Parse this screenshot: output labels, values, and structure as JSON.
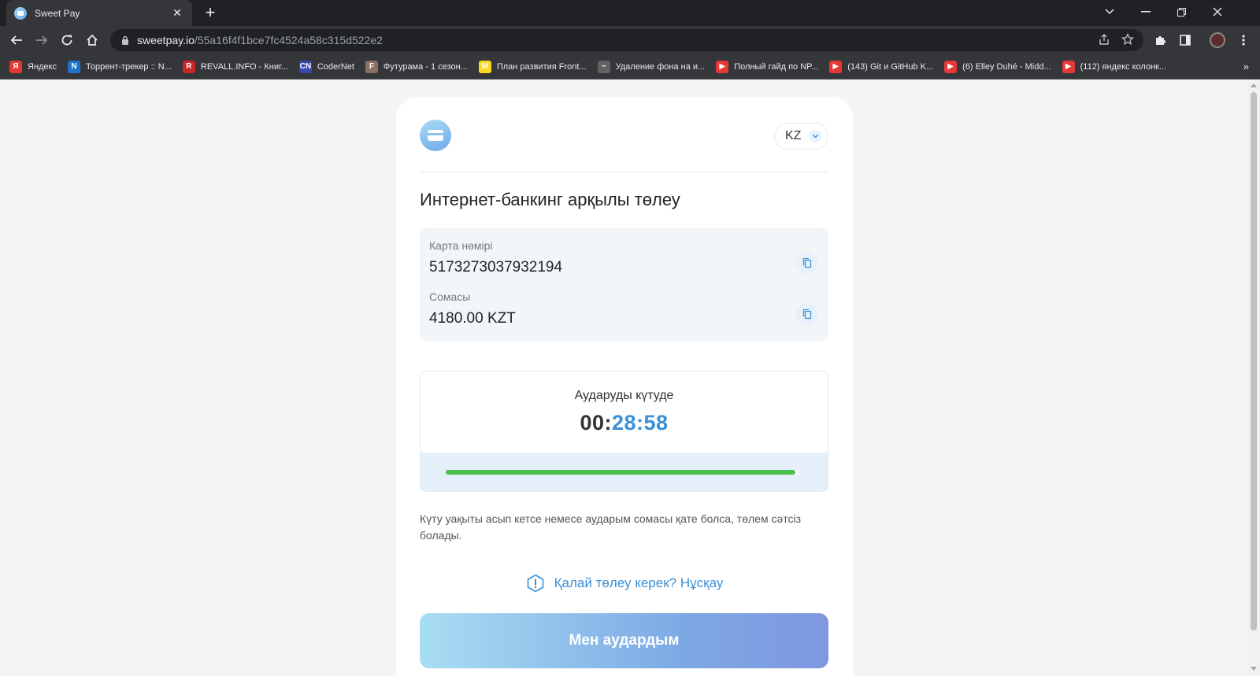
{
  "browser": {
    "tab_title": "Sweet Pay",
    "tab_close": "✕",
    "new_tab": "+",
    "url_host": "sweetpay.io",
    "url_path": "/55a16f4f1bce7fc4524a58c315d522e2",
    "bookmarks": [
      {
        "label": "Яндекс",
        "icon_text": "Я",
        "color": "#e53935"
      },
      {
        "label": "Торрент-трекер :: N...",
        "icon_text": "N",
        "color": "#1e73c8"
      },
      {
        "label": "REVALL.INFO - Книг...",
        "icon_text": "R",
        "color": "#c62828"
      },
      {
        "label": "CoderNet",
        "icon_text": "CN",
        "color": "#3949ab"
      },
      {
        "label": "Футурама - 1 сезон...",
        "icon_text": "F",
        "color": "#8d6e63"
      },
      {
        "label": "План развития Front...",
        "icon_text": "M",
        "color": "#f9d923"
      },
      {
        "label": "Удаление фона на и...",
        "icon_text": "~",
        "color": "#616161"
      },
      {
        "label": "Полный гайд по NP...",
        "icon_text": "▶",
        "color": "#e53935"
      },
      {
        "label": "(143) Git и GitHub K...",
        "icon_text": "▶",
        "color": "#e53935"
      },
      {
        "label": "(6) Elley Duhé - Midd...",
        "icon_text": "▶",
        "color": "#e53935"
      },
      {
        "label": "(112) яндекс колонк...",
        "icon_text": "▶",
        "color": "#e53935"
      }
    ],
    "bookmarks_more": "»"
  },
  "header": {
    "language": "KZ"
  },
  "title": "Интернет-банкинг арқылы төлеу",
  "payment": {
    "card_label": "Карта нөмірі",
    "card_number": "5173273037932194",
    "amount_label": "Сомасы",
    "amount": "4180.00 KZT"
  },
  "timer": {
    "label": "Аударуды күтуде",
    "hours": "00:",
    "minutes": "28:",
    "seconds": "58",
    "progress": 0.99
  },
  "note": "Күту уақыты асып кетсе немесе аударым сомасы қате болса, төлем сәтсіз болады.",
  "howto": "Қалай төлеу керек? Нұсқау",
  "submit": "Мен аудардым",
  "colors": {
    "accent": "#3b8fd9",
    "progress": "#4cbf4e",
    "chrome": "#35363a"
  }
}
